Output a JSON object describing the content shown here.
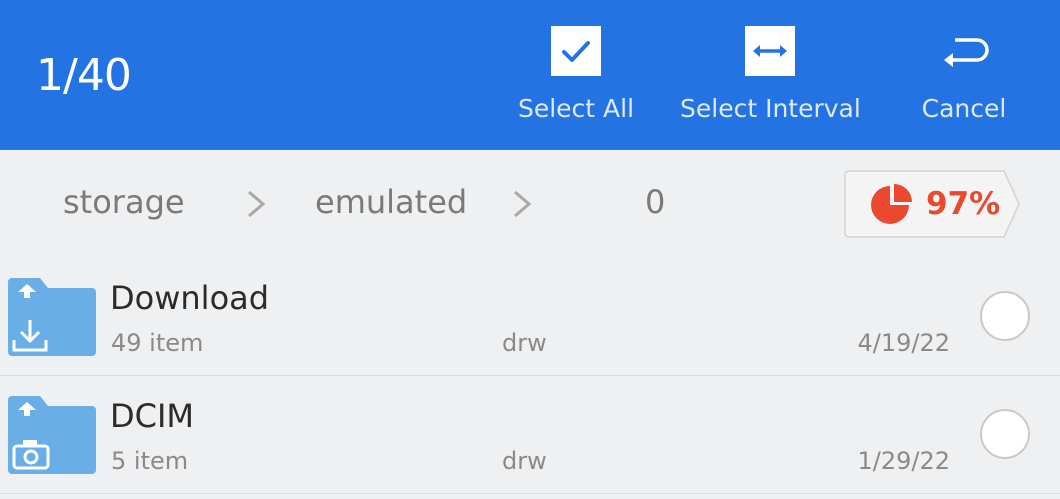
{
  "header": {
    "selection_count": "1/40",
    "actions": [
      {
        "label": "Select All",
        "icon": "checkbox-checked-icon"
      },
      {
        "label": "Select Interval",
        "icon": "interval-arrows-icon"
      },
      {
        "label": "Cancel",
        "icon": "return-arrow-icon"
      }
    ],
    "background_color": "#2473e3"
  },
  "breadcrumb": {
    "segments": [
      "storage",
      "emulated",
      "0"
    ],
    "storage_usage": "97%",
    "storage_icon": "pie-chart-icon",
    "usage_color": "#e8492f"
  },
  "files": [
    {
      "name": "Download",
      "count": "49 item",
      "permissions": "drw",
      "date": "4/19/22",
      "icon": "download-folder-icon",
      "selected": false
    },
    {
      "name": "DCIM",
      "count": "5 item",
      "permissions": "drw",
      "date": "1/29/22",
      "icon": "camera-folder-icon",
      "selected": false
    }
  ]
}
